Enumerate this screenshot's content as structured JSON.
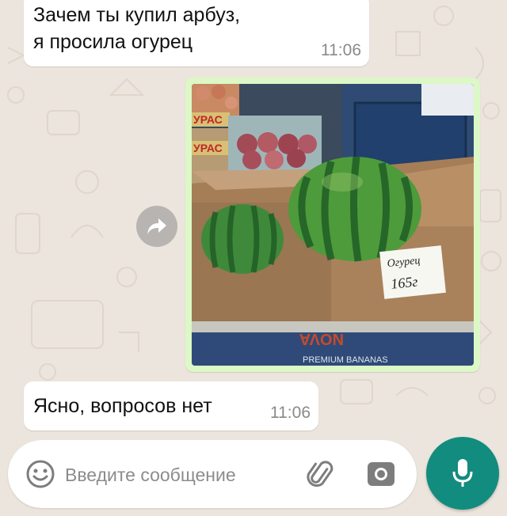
{
  "messages": [
    {
      "text": "Зачем ты купил арбуз,\nя просила огурец",
      "time": "11:06"
    },
    {
      "text": "Ясно, вопросов нет",
      "time": "11:06"
    }
  ],
  "photo": {
    "sign_line1": "Огурец",
    "sign_line2": "165г",
    "crate_label": "УРАС",
    "crate_label_2": "УРАС",
    "box_print": "NOVA",
    "box_print_2": "PREMIUM BANANAS"
  },
  "composer": {
    "placeholder": "Введите сообщение"
  },
  "icons": {
    "emoji": "emoji-icon",
    "attach": "paperclip-icon",
    "camera": "camera-icon",
    "mic": "microphone-icon",
    "forward": "forward-icon"
  },
  "colors": {
    "chat_background": "#ece5dd",
    "incoming_bubble": "#ffffff",
    "outgoing_bubble": "#dcf8c6",
    "accent": "#128c7e"
  }
}
